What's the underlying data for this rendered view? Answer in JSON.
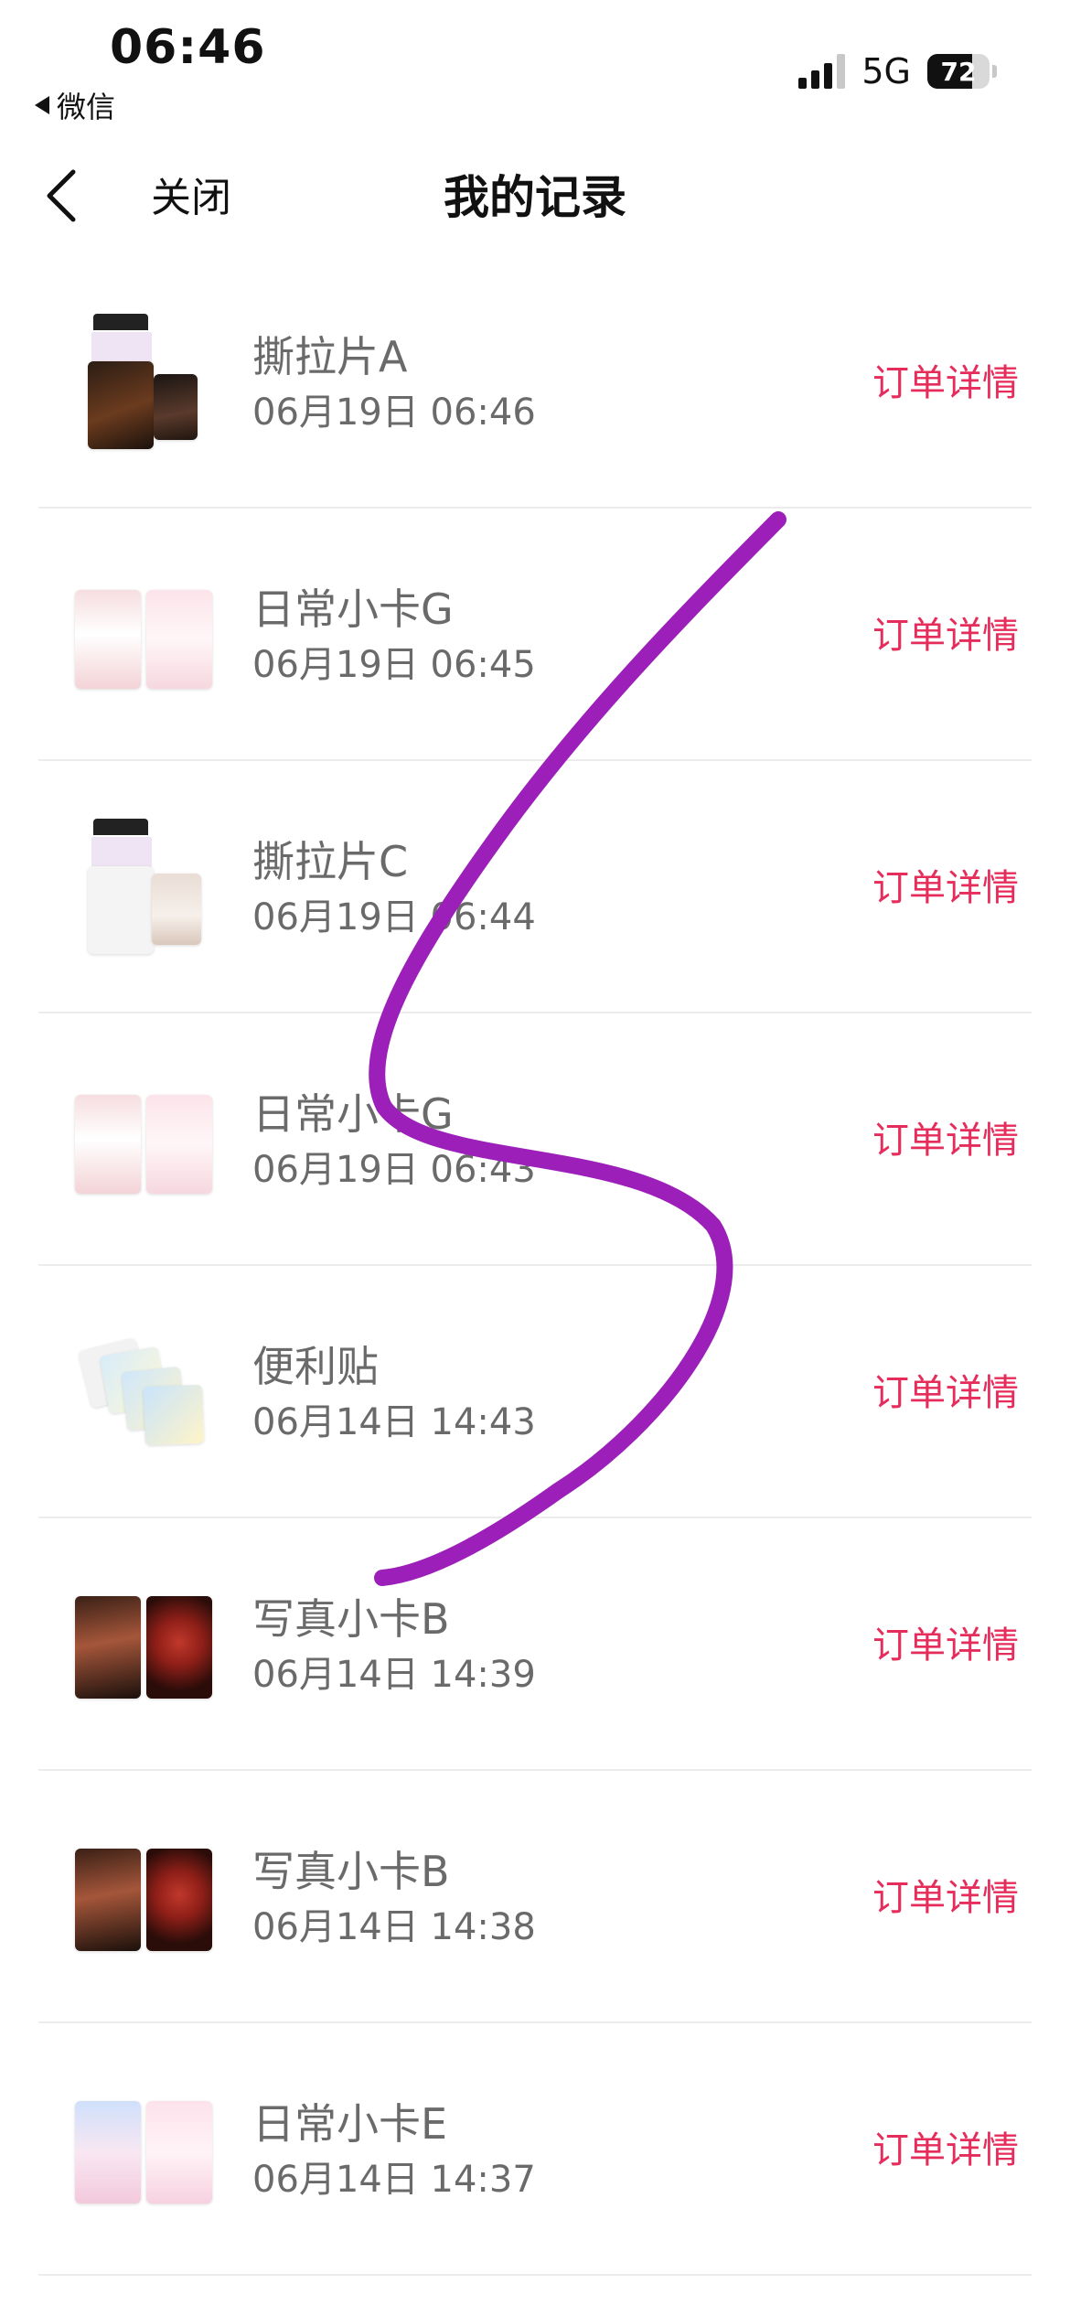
{
  "status_bar": {
    "time": "06:46",
    "back_to_app": "微信",
    "network": "5G",
    "battery": "72",
    "battery_level": 0.72
  },
  "nav": {
    "close": "关闭",
    "title": "我的记录"
  },
  "records": [
    {
      "name": "撕拉片A",
      "time": "06月19日 06:46",
      "action": "订单详情",
      "thumb": "tear-pack-dark"
    },
    {
      "name": "日常小卡G",
      "time": "06月19日 06:45",
      "action": "订单详情",
      "thumb": "pink-cards"
    },
    {
      "name": "撕拉片C",
      "time": "06月19日 06:44",
      "action": "订单详情",
      "thumb": "tear-pack-light"
    },
    {
      "name": "日常小卡G",
      "time": "06月19日 06:43",
      "action": "订单详情",
      "thumb": "pink-cards"
    },
    {
      "name": "便利贴",
      "time": "06月14日 14:43",
      "action": "订单详情",
      "thumb": "sticky-notes"
    },
    {
      "name": "写真小卡B",
      "time": "06月14日 14:39",
      "action": "订单详情",
      "thumb": "dark-red-cards"
    },
    {
      "name": "写真小卡B",
      "time": "06月14日 14:38",
      "action": "订单详情",
      "thumb": "dark-red-cards"
    },
    {
      "name": "日常小卡E",
      "time": "06月14日 14:37",
      "action": "订单详情",
      "thumb": "pastel-cards"
    }
  ],
  "colors": {
    "accent": "#e52c5a",
    "secondary_text": "#6a6a6a",
    "annotation_stroke": "#9b1fb8"
  }
}
